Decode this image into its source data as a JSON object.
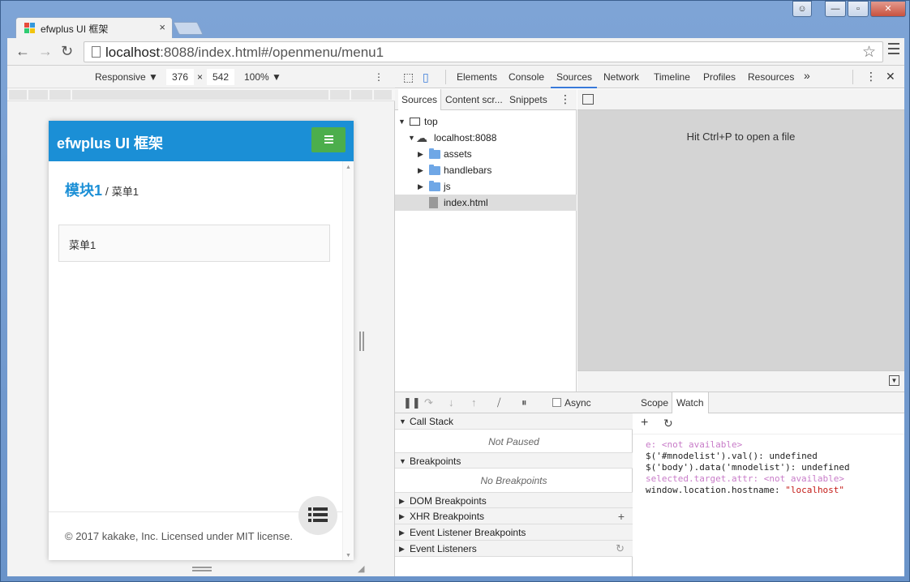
{
  "browser": {
    "tab_title": "efwplus UI 框架",
    "tab_close": "×",
    "url_host": "localhost",
    "url_rest": ":8088/index.html#/openmenu/menu1",
    "win_min": "—",
    "win_max": "▫",
    "win_close": "✕",
    "win_user": "☺"
  },
  "devmode": {
    "device": "Responsive ▼",
    "width": "376",
    "times": "×",
    "height": "542",
    "zoom": "100% ▼",
    "more": "⋮"
  },
  "app": {
    "title": "efwplus UI 框架",
    "module": "模块1",
    "separator": " / ",
    "current": "菜单1",
    "card_label": "菜单1",
    "footer": "© 2017 kakake, Inc. Licensed under MIT license.",
    "header_color": "#1b8fd6",
    "menu_button_color": "#4cae4c"
  },
  "devtools": {
    "tabs": [
      "Elements",
      "Console",
      "Sources",
      "Network",
      "Timeline",
      "Profiles",
      "Resources"
    ],
    "active_tab": "Sources",
    "overflow": "»",
    "more": "⋮",
    "close": "✕",
    "subtabs": [
      "Sources",
      "Content scr...",
      "Snippets"
    ],
    "subtabs_more": "⋮",
    "tree": {
      "top": "top",
      "host": "localhost:8088",
      "folders": [
        "assets",
        "handlebars",
        "js"
      ],
      "file": "index.html"
    },
    "editor_hint": "Hit Ctrl+P to open a file",
    "async_label": "Async",
    "sections": {
      "call_stack": "Call Stack",
      "not_paused": "Not Paused",
      "breakpoints": "Breakpoints",
      "no_breakpoints": "No Breakpoints",
      "dom_breakpoints": "DOM Breakpoints",
      "xhr_breakpoints": "XHR Breakpoints",
      "event_listener_breakpoints": "Event Listener Breakpoints",
      "event_listeners": "Event Listeners"
    },
    "watch_tabs": [
      "Scope",
      "Watch"
    ],
    "watch_add": "+",
    "watch_refresh": "↻",
    "watch": [
      {
        "key": "e:",
        "value": "<not available>",
        "kind": "na"
      },
      {
        "key": "$('#mnodelist').val():",
        "value": "undefined",
        "kind": "ok"
      },
      {
        "key": "$('body').data('mnodelist'):",
        "value": "undefined",
        "kind": "ok"
      },
      {
        "key": "selected.target.attr:",
        "value": "<not available>",
        "kind": "na"
      },
      {
        "key": "window.location.hostname:",
        "value": "\"localhost\"",
        "kind": "str"
      }
    ]
  }
}
